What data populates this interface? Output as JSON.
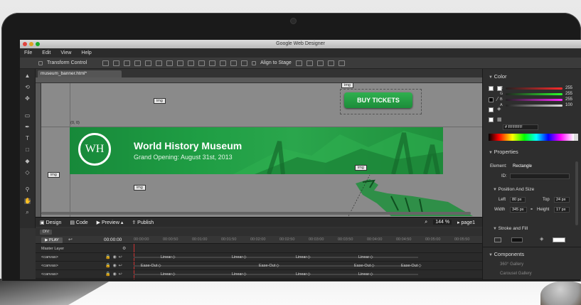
{
  "window": {
    "title": "Google Web Designer"
  },
  "menu": [
    "File",
    "Edit",
    "View",
    "Help"
  ],
  "toolbar": {
    "transform_label": "Transform Control",
    "align_label": "Align to Stage"
  },
  "document": {
    "tab_label": "museum_banner.html*",
    "coords_label": "(0, 0)"
  },
  "stage": {
    "img_tag": "img",
    "banner": {
      "logo_text": "WH",
      "title": "World History Museum",
      "subtitle": "Grand Opening: August 31st, 2013"
    },
    "buy_button": "BUY TICKETS"
  },
  "modebar": {
    "design": "Design",
    "code": "Code",
    "preview": "Preview",
    "publish": "Publish",
    "zoom": "144",
    "zoom_unit": "%",
    "page": "page1"
  },
  "timeline": {
    "breadcrumb": "DIV",
    "play_label": "PLAY",
    "time": "00:00:00",
    "ticks": [
      "00:00:00",
      "00:00:50",
      "00:01:00",
      "00:01:50",
      "00:02:00",
      "00:02:50",
      "00:03:00",
      "00:03:50",
      "00:04:00",
      "00:04:50",
      "00:05:00",
      "00:05:50",
      "00:06:00"
    ],
    "layers": [
      {
        "name": "Master Layer",
        "keyframes": []
      },
      {
        "name": "<canvas>",
        "keyframes": [
          "Linear",
          "Linear",
          "Linear",
          "Linear"
        ]
      },
      {
        "name": "<canvas>",
        "keyframes": [
          "Ease-Out",
          "Ease-Out",
          "Ease-Out",
          "Ease-Out"
        ]
      },
      {
        "name": "<canvas>",
        "keyframes": [
          "Linear",
          "Linear",
          "Linear",
          "Linear"
        ]
      }
    ]
  },
  "panel": {
    "color": {
      "title": "Color",
      "channels": [
        {
          "label": "R",
          "value": "255",
          "color": "#ff2a2a"
        },
        {
          "label": "G",
          "value": "255",
          "color": "#2aff2a"
        },
        {
          "label": "B",
          "value": "255",
          "color": "#ff2aff"
        },
        {
          "label": "A",
          "value": "100",
          "color": "#dddddd"
        }
      ],
      "hex_prefix": "#",
      "hex": "FFFFFF"
    },
    "properties": {
      "title": "Properties",
      "element_label": "Element:",
      "element_value": "Rectangle",
      "id_label": "ID:",
      "position_title": "Position And Size",
      "left_label": "Left",
      "left_value": "80",
      "left_unit": "px",
      "top_label": "Top",
      "top_value": "24",
      "top_unit": "px",
      "width_label": "Width",
      "width_value": "345",
      "width_unit": "px",
      "height_label": "Height",
      "height_value": "17",
      "height_unit": "px",
      "stroke_title": "Stroke and Fill"
    },
    "components": {
      "title": "Components",
      "items": [
        "360° Gallery",
        "Carousel Gallery"
      ]
    }
  }
}
